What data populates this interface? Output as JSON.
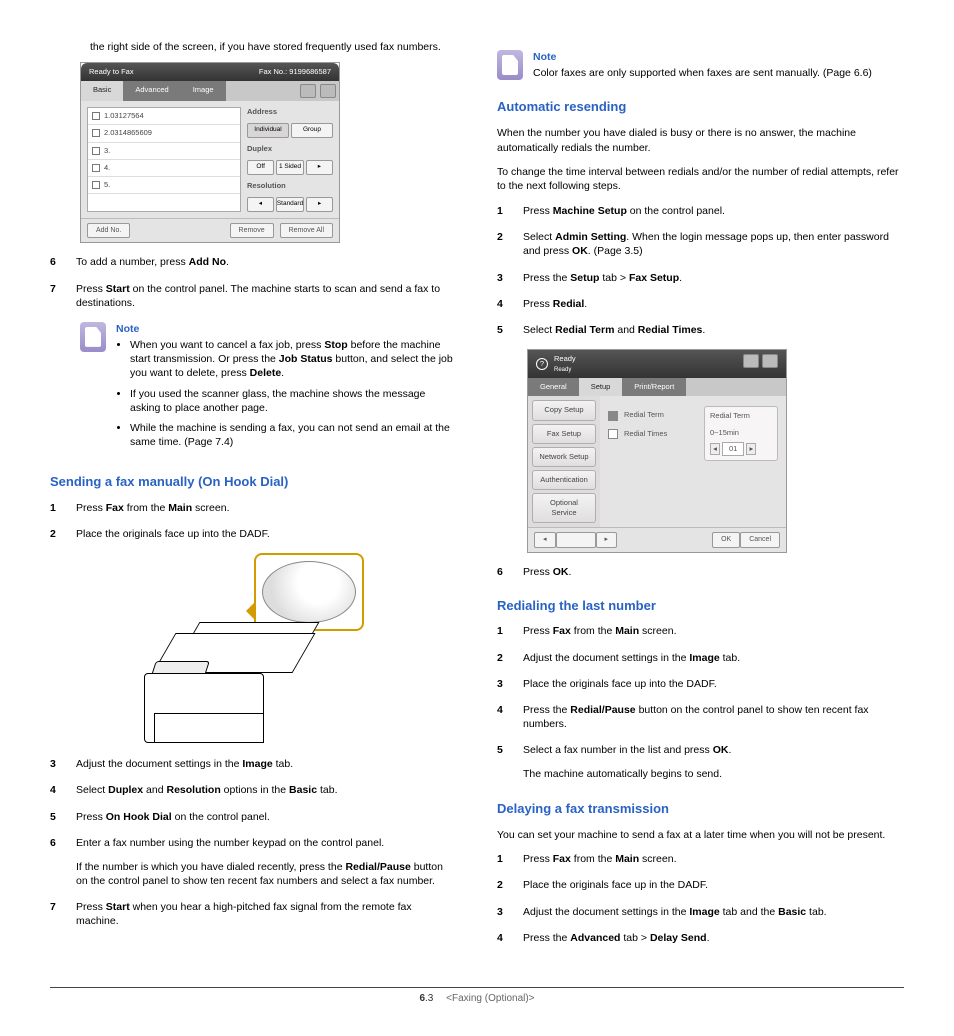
{
  "leftColumn": {
    "intro": "the right side of the screen, if you have stored frequently used fax numbers.",
    "ui1": {
      "titleLeft": "Ready to Fax",
      "titleRight": "Fax No.: 9199686587",
      "tabs": [
        "Basic",
        "Advanced",
        "Image"
      ],
      "listItems": [
        "1.03127564",
        "2.0314865609",
        "3.",
        "4.",
        "5."
      ],
      "side": {
        "addressLabel": "Address",
        "addressBtns": [
          "Individual",
          "Group"
        ],
        "duplexLabel": "Duplex",
        "duplexBtns": [
          "Off",
          "1 Sided"
        ],
        "resLabel": "Resolution",
        "resBtns": [
          "",
          "Standard",
          ""
        ]
      },
      "footBtns": [
        "Add No.",
        "",
        "Remove",
        "Remove All"
      ]
    },
    "step6": {
      "text": "To add a number, press ",
      "b": "Add No",
      "after": "."
    },
    "step7": {
      "a": "Press ",
      "b": "Start",
      "c": " on the control panel. The machine starts to scan and send a fax to destinations."
    },
    "note1": {
      "title": "Note",
      "items": [
        {
          "a": "When you want to cancel a fax job, press ",
          "b1": "Stop",
          "c": " before the machine start transmission. Or press the ",
          "b2": "Job Status",
          "d": " button, and select the job you want to delete, press ",
          "b3": "Delete",
          "e": "."
        },
        {
          "a": "If you used the scanner glass, the machine shows the message asking to place another page."
        },
        {
          "a": "While the machine is sending a fax, you can not send an email at the same time. (Page 7.4)"
        }
      ]
    },
    "h1": "Sending a fax manually (On Hook Dial)",
    "s1": {
      "a": "Press ",
      "b1": "Fax",
      "c": " from the ",
      "b2": "Main",
      "d": " screen."
    },
    "s2": "Place the originals face up into the DADF.",
    "s3": {
      "a": "Adjust the document settings in the ",
      "b": "Image",
      "c": " tab."
    },
    "s4": {
      "a": "Select ",
      "b1": "Duplex",
      "c": " and ",
      "b2": "Resolution",
      "d": " options in the ",
      "b3": "Basic",
      "e": " tab."
    },
    "s5": {
      "a": "Press ",
      "b": "On Hook Dial",
      "c": " on the control panel."
    },
    "s6": "Enter a fax number using the number keypad on the control panel.",
    "s6sub": {
      "a": "If the number is which you have dialed recently, press the ",
      "b": "Redial/Pause",
      "c": " button on the control panel to show ten recent fax numbers and select a fax number."
    },
    "s7": {
      "a": "Press ",
      "b": "Start",
      "c": " when you hear a high-pitched fax signal from the remote fax machine."
    }
  },
  "rightColumn": {
    "note2": {
      "title": "Note",
      "text": "Color faxes are only supported when faxes are sent manually. (Page 6.6)"
    },
    "h2": "Automatic resending",
    "p1": "When the number you have dialed is busy or there is no answer, the machine automatically redials the number.",
    "p2": "To change the time interval between redials and/or the number of redial attempts, refer to the next following steps.",
    "a1": {
      "a": "Press ",
      "b": "Machine Setup",
      "c": " on the control panel."
    },
    "a2": {
      "a": "Select ",
      "b1": "Admin Setting",
      "c": ". When the login message pops up, then enter password and press ",
      "b2": "OK",
      "d": ". (Page 3.5)"
    },
    "a3": {
      "a": "Press the ",
      "b1": "Setup",
      "c": " tab > ",
      "b2": "Fax Setup",
      "d": "."
    },
    "a4": {
      "a": "Press ",
      "b": "Redial",
      "c": "."
    },
    "a5": {
      "a": "Select ",
      "b1": "Redial Term",
      "c": " and ",
      "b2": "Redial Times",
      "d": "."
    },
    "ui2": {
      "titleLeft": "Ready",
      "titleSub": "Ready",
      "tabs": [
        "General",
        "Setup",
        "Print/Report"
      ],
      "sideBtns": [
        "Copy Setup",
        "Fax Setup",
        "Network Setup",
        "Authentication",
        "Optional Service"
      ],
      "items": [
        "Redial Term",
        "Redial Times"
      ],
      "rightLabel": "Redial Term",
      "rightRange": "0~15min",
      "rightVal": "01",
      "ok": "OK",
      "cancel": "Cancel"
    },
    "a6": {
      "a": "Press ",
      "b": "OK",
      "c": "."
    },
    "h3": "Redialing the last number",
    "r1": {
      "a": "Press ",
      "b1": "Fax",
      "c": " from the ",
      "b2": "Main",
      "d": " screen."
    },
    "r2": {
      "a": "Adjust the document settings in the ",
      "b": "Image",
      "c": " tab."
    },
    "r3": "Place the originals face up into the DADF.",
    "r4": {
      "a": "Press the ",
      "b": "Redial/Pause",
      "c": " button on the control panel to show ten recent fax numbers."
    },
    "r5": {
      "a": "Select a fax number in the list and press ",
      "b": "OK",
      "c": "."
    },
    "r5sub": "The machine automatically begins to send.",
    "h4": "Delaying a fax transmission",
    "d0": "You can set your machine to send a fax at a later time when you will not be present.",
    "d1": {
      "a": "Press ",
      "b1": "Fax",
      "c": " from the ",
      "b2": "Main",
      "d": " screen."
    },
    "d2": "Place the originals face up in the DADF.",
    "d3": {
      "a": "Adjust the document settings in the ",
      "b1": "Image",
      "c": " tab and the ",
      "b2": "Basic",
      "d": " tab."
    },
    "d4": {
      "a": "Press the ",
      "b1": "Advanced",
      "c": " tab > ",
      "b2": "Delay Send",
      "d": "."
    }
  },
  "footer": {
    "chapter": "6",
    "page": ".3",
    "title": "<Faxing (Optional)>"
  }
}
